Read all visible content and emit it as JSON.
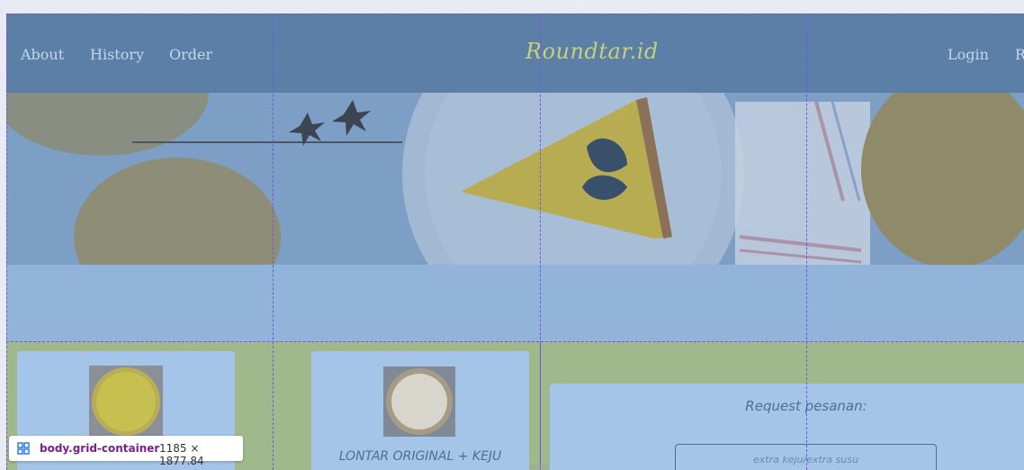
{
  "nav": {
    "left_links": [
      "About",
      "History",
      "Order"
    ],
    "brand": "Roundtar.id",
    "login": "Login",
    "cut_off": "R"
  },
  "products": [
    {
      "title": "",
      "image_icon": "yellow-tart-icon"
    },
    {
      "title": "LONTAR ORIGINAL + KEJU",
      "image_icon": "cheese-tart-icon"
    }
  ],
  "request": {
    "label": "Request pesanan:",
    "placeholder": "extra keju/extra susu"
  },
  "devtools": {
    "selector": "body.grid-container",
    "size": "1185 × 1877.84"
  },
  "colors": {
    "navbar": "#5b7fa6",
    "brand": "#c9cf7a",
    "green_section": "#9fb98c",
    "card": "#a4c4e8",
    "grid_overlay": "#7b52e0"
  }
}
